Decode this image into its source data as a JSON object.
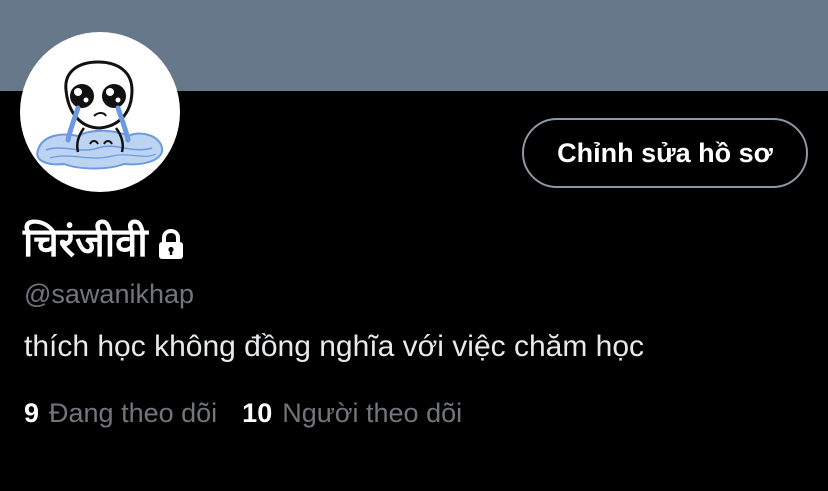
{
  "colors": {
    "banner": "#66788a",
    "background": "#000000",
    "primary_text": "#ffffff",
    "secondary_text": "#71767b",
    "button_border": "#8b98a5"
  },
  "profile": {
    "display_name": "चिरंजीवी",
    "protected_icon": "lock-icon",
    "handle": "@sawanikhap",
    "bio": "thích học không đồng nghĩa với việc chăm học",
    "edit_button_label": "Chỉnh sửa hồ sơ"
  },
  "stats": {
    "following": {
      "count": "9",
      "label": "Đang theo dõi"
    },
    "followers": {
      "count": "10",
      "label": "Người theo dõi"
    }
  }
}
